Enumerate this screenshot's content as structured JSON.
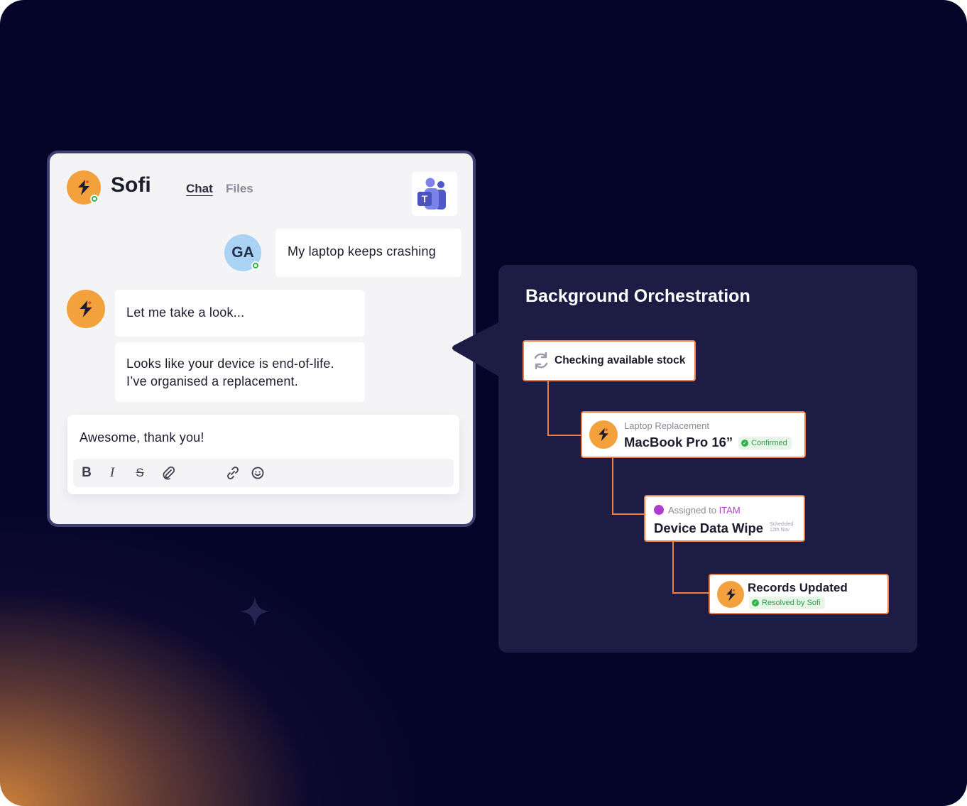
{
  "chat": {
    "app_name": "Sofi",
    "tabs": [
      {
        "label": "Chat"
      },
      {
        "label": "Files"
      }
    ],
    "teams_icon": "microsoft-teams-icon",
    "messages": [
      {
        "sender": "user",
        "avatar_initials": "GA",
        "text": "My laptop keeps crashing"
      },
      {
        "sender": "sofi",
        "text": "Let me take a look..."
      },
      {
        "sender": "sofi",
        "text_line1": "Looks like your device is end-of-life.",
        "text_line2": "I’ve organised a replacement."
      }
    ],
    "composer": {
      "text": "Awesome, thank you!",
      "tools": [
        {
          "icon": "bold-icon",
          "glyph": "B"
        },
        {
          "icon": "italic-icon",
          "glyph": "I"
        },
        {
          "icon": "strikethrough-icon",
          "glyph": "S"
        },
        {
          "icon": "attachment-icon"
        },
        {
          "icon": "link-icon"
        },
        {
          "icon": "emoji-icon"
        }
      ]
    }
  },
  "orchestration": {
    "title": "Background Orchestration",
    "steps": [
      {
        "label": "Checking available stock",
        "icon": "sync-icon"
      },
      {
        "sublabel": "Laptop Replacement",
        "title": "MacBook Pro 16”",
        "status": "Confirmed"
      },
      {
        "sublabel_prefix": "Assigned to",
        "sublabel_team": "ITAM",
        "title": "Device Data Wipe",
        "note_line1": "Scheduled",
        "note_line2": "12th Nov"
      },
      {
        "title": "Records Updated",
        "status": "Resolved by Sofi"
      }
    ]
  },
  "colors": {
    "background": "#05052a",
    "accent_orange": "#f2a13c",
    "node_border": "#ef7e45",
    "panel": "#1d1c45",
    "card_border": "#3f3f72",
    "presence_green": "#2fb34a",
    "itam_purple": "#b03ccf"
  }
}
